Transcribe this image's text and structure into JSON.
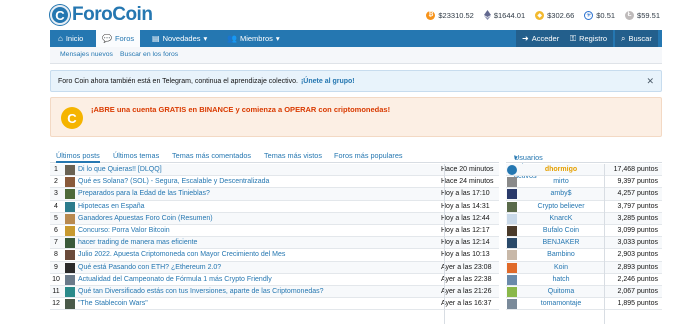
{
  "logo": {
    "left_text": "Foro",
    "right_text": "Coin",
    "mark": "C"
  },
  "prices": [
    {
      "coin": "btc-icon",
      "color": "#f7931a",
      "value": "$23310.52"
    },
    {
      "coin": "eth-icon",
      "color": "#62688f",
      "value": "$1644.01"
    },
    {
      "coin": "bnb-icon",
      "color": "#f3ba2f",
      "value": "$302.66"
    },
    {
      "coin": "ada-icon",
      "color": "#2a71d0",
      "value": "$0.51"
    },
    {
      "coin": "ltc-icon",
      "color": "#bfbbbb",
      "value": "$59.51"
    }
  ],
  "nav": {
    "inicio": "Inicio",
    "foros": "Foros",
    "novedades": "Novedades",
    "miembros": "Miembros",
    "acceder": "Acceder",
    "registro": "Registro",
    "buscar": "Buscar"
  },
  "subnav": {
    "mensajes_nuevos": "Mensajes nuevos",
    "buscar_foros": "Buscar en los foros"
  },
  "notice": {
    "text": "Foro Coin ahora también está en Telegram, continua el aprendizaje colectivo.",
    "link": "¡Únete al grupo!"
  },
  "promo": {
    "text": "¡ABRE una cuenta GRATIS en BINANCE y comienza a OPERAR con criptomonedas!"
  },
  "tabs": [
    "Últimos posts",
    "Últimos temas",
    "Temas más comentados",
    "Temas más vistos",
    "Foros más populares"
  ],
  "users_header": "Usuarios más activos",
  "posts": [
    {
      "n": "1",
      "title": "Di lo que Quieras!! [DLQQ]",
      "time": "Hace 20 minutos",
      "thumb": "#6a6253"
    },
    {
      "n": "2",
      "title": "Qué es Solana? (SOL) - Segura, Escalable y Descentralizada",
      "time": "Hace 24 minutos",
      "thumb": "#8a5a3a"
    },
    {
      "n": "3",
      "title": "Preparados para la Edad de las Tinieblas?",
      "time": "Hoy a las 17:10",
      "thumb": "#4e6a3a"
    },
    {
      "n": "4",
      "title": "Hipotecas en España",
      "time": "Hoy a las 14:31",
      "thumb": "#2c7c8c"
    },
    {
      "n": "5",
      "title": "Ganadores Apuestas Foro Coin (Resumen)",
      "time": "Hoy a las 12:44",
      "thumb": "#b88a50"
    },
    {
      "n": "6",
      "title": "Concurso: Porra Valor Bitcoin",
      "time": "Hoy a las 12:17",
      "thumb": "#c89a30"
    },
    {
      "n": "7",
      "title": "hacer trading de manera mas eficiente",
      "time": "Hoy a las 12:14",
      "thumb": "#3a5a3a"
    },
    {
      "n": "8",
      "title": "Julio 2022. Apuesta Criptomoneda con Mayor Crecimiento del Mes",
      "time": "Hoy a las 10:13",
      "thumb": "#6a4a3a"
    },
    {
      "n": "9",
      "title": "Qué está Pasando con ETH? ¿Ethereum 2.0?",
      "time": "Ayer a las 23:08",
      "thumb": "#2a2a2a"
    },
    {
      "n": "10",
      "title": "Actualidad del Campeonato de Fórmula 1 más Crypto Friendly",
      "time": "Ayer a las 22:38",
      "thumb": "#6a7a8a"
    },
    {
      "n": "11",
      "title": "Qué tan Diversificado estás con tus Inversiones, aparte de las Criptomonedas?",
      "time": "Ayer a las 21:26",
      "thumb": "#2a8a8a"
    },
    {
      "n": "12",
      "title": "\"The Stablecoin Wars\"",
      "time": "Ayer a las 16:37",
      "thumb": "#4a5a4a"
    }
  ],
  "users": [
    {
      "name": "dhormigo",
      "points": "17,468 puntos",
      "top": true,
      "av": "#2577b1"
    },
    {
      "name": "mirto",
      "points": "9,397 puntos",
      "av": "#8a8a8a"
    },
    {
      "name": "amby$",
      "points": "4,257 puntos",
      "av": "#2a3a6a"
    },
    {
      "name": "Crypto believer",
      "points": "3,797 puntos",
      "av": "#5a6a4a"
    },
    {
      "name": "KnarcK",
      "points": "3,285 puntos",
      "av": "#c8d8e8"
    },
    {
      "name": "Bufalo Coin",
      "points": "3,099 puntos",
      "av": "#4a3a2a"
    },
    {
      "name": "BENJAKER",
      "points": "3,033 puntos",
      "av": "#2a4a6a"
    },
    {
      "name": "Bambino",
      "points": "2,903 puntos",
      "av": "#c8b8a8"
    },
    {
      "name": "Koin",
      "points": "2,893 puntos",
      "av": "#e06a2a"
    },
    {
      "name": "hatch",
      "points": "2,246 puntos",
      "av": "#6a8aaa"
    },
    {
      "name": "Quitoma",
      "points": "2,067 puntos",
      "av": "#8ab84a"
    },
    {
      "name": "tomamontaje",
      "points": "1,895 puntos",
      "av": "#7a8a9a"
    }
  ]
}
